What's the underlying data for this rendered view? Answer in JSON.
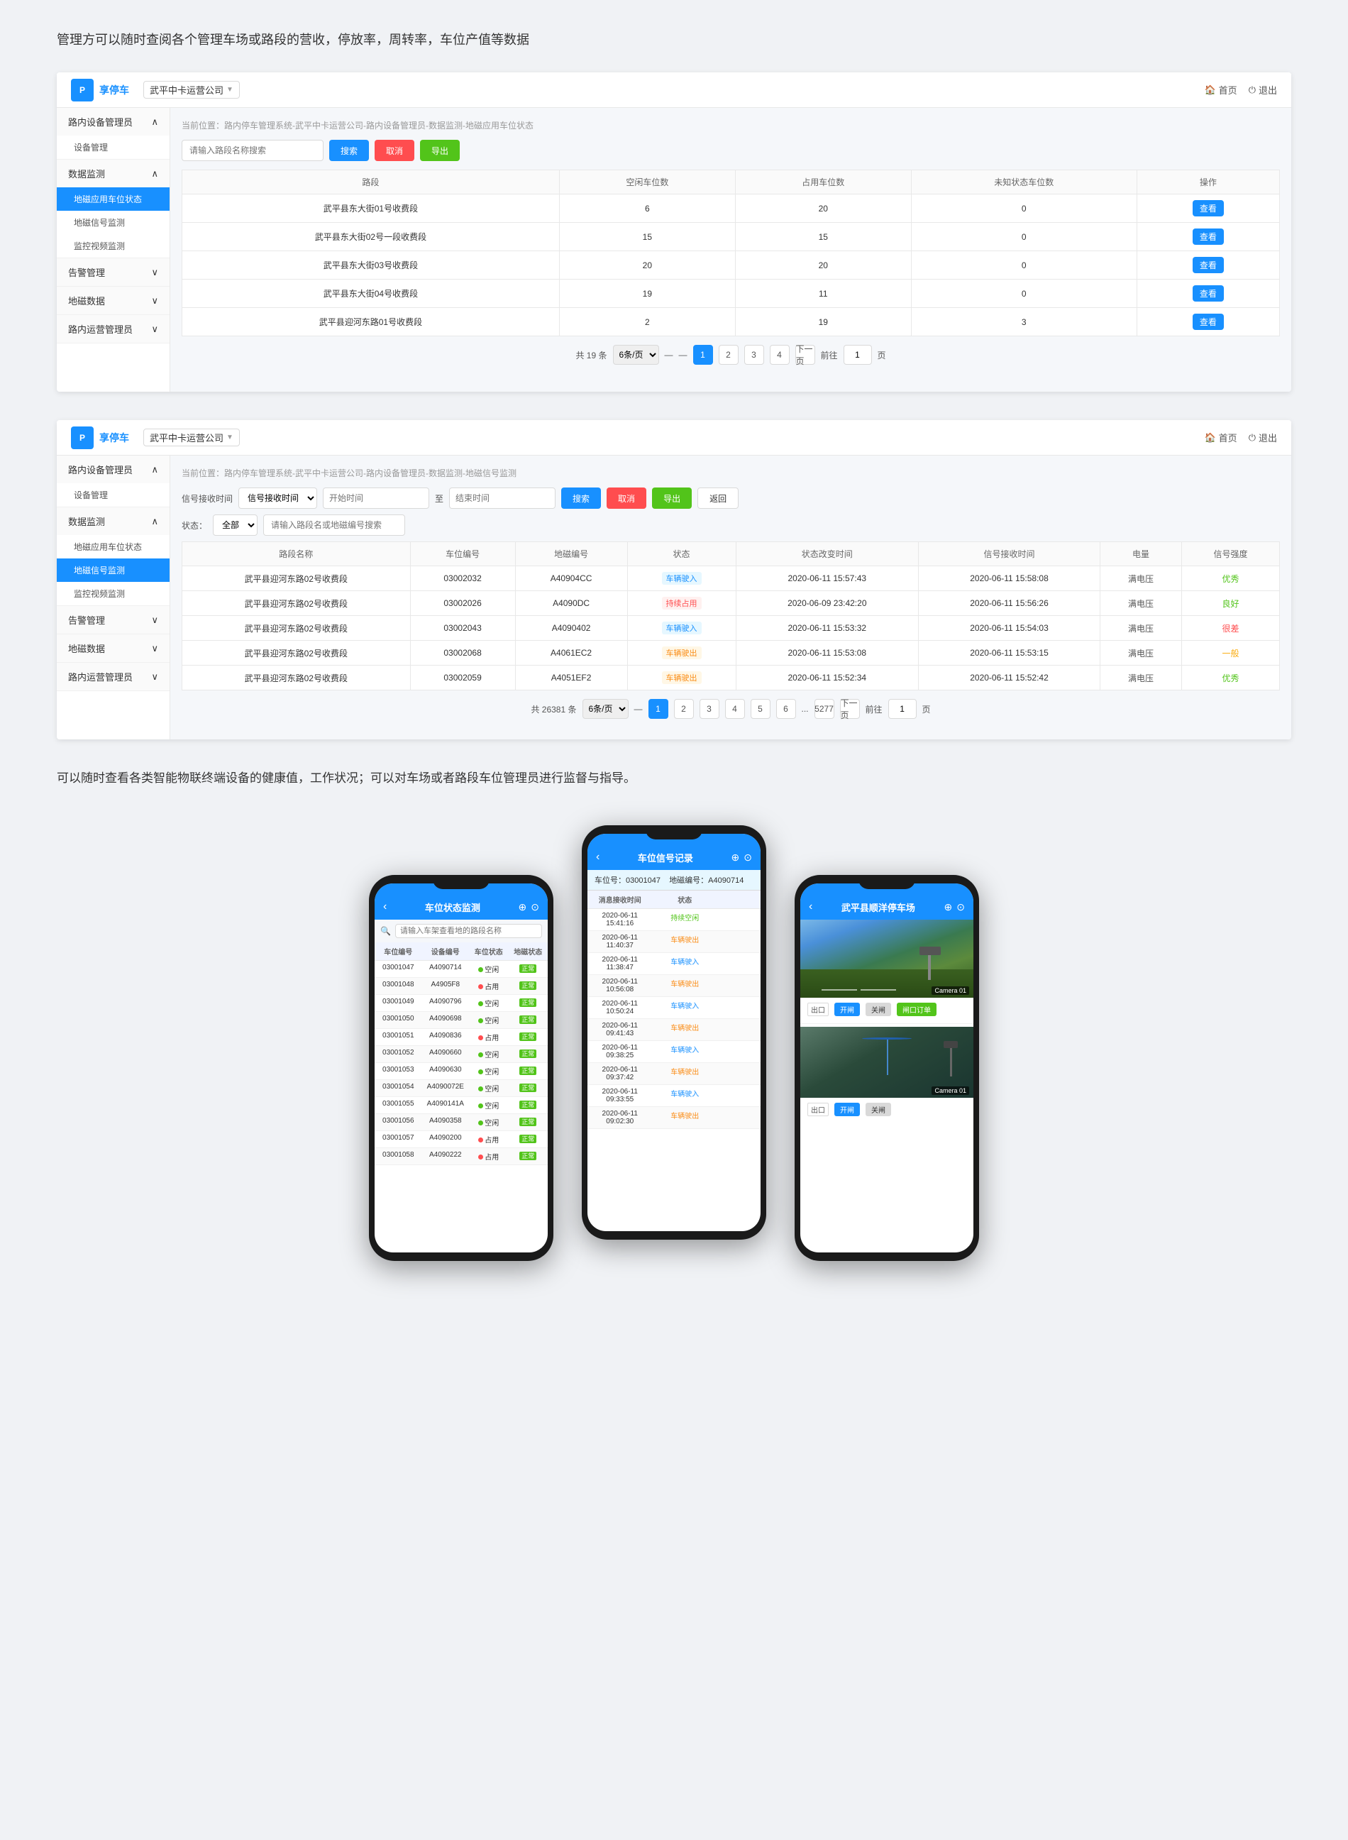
{
  "intro1": {
    "text": "管理方可以随时查阅各个管理车场或路段的营收，停放率，周转率，车位产值等数据"
  },
  "intro2": {
    "text": "可以随时查看各类智能物联终端设备的健康值，工作状况；可以对车场或者路段车位管理员进行监督与指导。"
  },
  "panel1": {
    "topbar": {
      "logo": "P享停车",
      "company": "武平中卡运营公司",
      "nav_home": "首页",
      "nav_logout": "退出"
    },
    "breadcrumb": "当前位置：路内停车管理系统-武平中卡运营公司-路内设备管理员-数据监测-地磁应用车位状态",
    "sidebar": {
      "section1": "路内设备管理员",
      "item1": "设备管理",
      "section2": "数据监测",
      "item2_1": "地磁应用车位状态",
      "item2_2": "地磁信号监测",
      "item2_3": "监控视频监测",
      "section3": "告警管理",
      "section4": "地磁数据",
      "section5": "路内运营管理员"
    },
    "search_placeholder": "请输入路段名称搜索",
    "btn_search": "搜索",
    "btn_reset": "取消",
    "btn_export": "导出",
    "table": {
      "headers": [
        "路段",
        "空闲车位数",
        "占用车位数",
        "未知状态车位数",
        "操作"
      ],
      "rows": [
        {
          "name": "武平县东大街01号收费段",
          "free": "6",
          "occupied": "20",
          "unknown": "0"
        },
        {
          "name": "武平县东大街02号一段收费段",
          "free": "15",
          "occupied": "15",
          "unknown": "0"
        },
        {
          "name": "武平县东大街03号收费段",
          "free": "20",
          "occupied": "20",
          "unknown": "0"
        },
        {
          "name": "武平县东大街04号收费段",
          "free": "19",
          "occupied": "11",
          "unknown": "0"
        },
        {
          "name": "武平县迎河东路01号收费段",
          "free": "2",
          "occupied": "19",
          "unknown": "3"
        }
      ],
      "btn_view": "查看"
    },
    "pagination": {
      "total": "共 19 条",
      "per_page": "6条/页",
      "pages": [
        "1",
        "2",
        "3",
        "4"
      ],
      "next": "下一页",
      "prev": "前往",
      "go_page": "1",
      "page_unit": "页"
    }
  },
  "panel2": {
    "topbar": {
      "logo": "P享停车",
      "company": "武平中卡运营公司",
      "nav_home": "首页",
      "nav_logout": "退出"
    },
    "breadcrumb": "当前位置：路内停车管理系统-武平中卡运营公司-路内设备管理员-数据监测-地磁信号监测",
    "sidebar": {
      "section1": "路内设备管理员",
      "item1": "设备管理",
      "section2": "数据监测",
      "item2_1": "地磁应用车位状态",
      "item2_2": "地磁信号监测",
      "item2_3": "监控视频监测",
      "section3": "告警管理",
      "section4": "地磁数据",
      "section5": "路内运营管理员"
    },
    "toolbar": {
      "label_time": "信号接收时间",
      "placeholder_start": "开始时间",
      "separator": "至",
      "placeholder_end": "结束时间",
      "btn_search": "搜索",
      "btn_reset": "取消",
      "btn_export": "导出",
      "btn_back": "返回",
      "label_status": "状态：",
      "status_options": [
        "全部"
      ],
      "search_placeholder": "请输入路段名或地磁编号搜索"
    },
    "table": {
      "headers": [
        "路段名称",
        "车位编号",
        "地磁编号",
        "状态",
        "状态改变时间",
        "信号接收时间",
        "电量",
        "信号强度"
      ],
      "rows": [
        {
          "name": "武平县迎河东路02号收费段",
          "slot": "03002032",
          "geo": "A40904CC",
          "status": "车辆驶入",
          "status_time": "2020-06-11 15:57:43",
          "signal_time": "2020-06-11 15:58:08",
          "power": "满电压",
          "quality": "优秀"
        },
        {
          "name": "武平县迎河东路02号收费段",
          "slot": "03002026",
          "geo": "A4090DC",
          "status": "持续占用",
          "status_time": "2020-06-09 23:42:20",
          "signal_time": "2020-06-11 15:56:26",
          "power": "满电压",
          "quality": "良好"
        },
        {
          "name": "武平县迎河东路02号收费段",
          "slot": "03002043",
          "geo": "A4090402",
          "status": "车辆驶入",
          "status_time": "2020-06-11 15:53:32",
          "signal_time": "2020-06-11 15:54:03",
          "power": "满电压",
          "quality": "很差"
        },
        {
          "name": "武平县迎河东路02号收费段",
          "slot": "03002068",
          "geo": "A4061EC2",
          "status": "车辆驶出",
          "status_time": "2020-06-11 15:53:08",
          "signal_time": "2020-06-11 15:53:15",
          "power": "满电压",
          "quality": "一般"
        },
        {
          "name": "武平县迎河东路02号收费段",
          "slot": "03002059",
          "geo": "A4051EF2",
          "status": "车辆驶出",
          "status_time": "2020-06-11 15:52:34",
          "signal_time": "2020-06-11 15:52:42",
          "power": "满电压",
          "quality": "优秀"
        }
      ]
    },
    "pagination": {
      "total": "共 26381 条",
      "per_page": "6条/页",
      "pages": [
        "1",
        "2",
        "3",
        "4",
        "5",
        "6",
        "...",
        "5277"
      ],
      "next": "下一页",
      "prev": "前往",
      "go_page": "1",
      "page_unit": "页"
    }
  },
  "phone1": {
    "title": "车位状态监测",
    "search_placeholder": "请输入车架查看地的路段名称",
    "table_headers": [
      "车位编号",
      "设备编号",
      "车位状态",
      "地磁状态"
    ],
    "rows": [
      {
        "slot": "03001047",
        "device": "A4090714",
        "slot_status": "空闲",
        "geo_status": "正常"
      },
      {
        "slot": "03001048",
        "device": "A4905F8",
        "slot_status": "占用",
        "geo_status": "正常"
      },
      {
        "slot": "03001049",
        "device": "A4090796",
        "slot_status": "空闲",
        "geo_status": "正常"
      },
      {
        "slot": "03001050",
        "device": "A4090698",
        "slot_status": "空闲",
        "geo_status": "正常"
      },
      {
        "slot": "03001051",
        "device": "A4090836",
        "slot_status": "占用",
        "geo_status": "正常"
      },
      {
        "slot": "03001052",
        "device": "A4090660",
        "slot_status": "空闲",
        "geo_status": "正常"
      },
      {
        "slot": "03001053",
        "device": "A4090630",
        "slot_status": "空闲",
        "geo_status": "正常"
      },
      {
        "slot": "03001054",
        "device": "A4090072E",
        "slot_status": "空闲",
        "geo_status": "正常"
      },
      {
        "slot": "03001055",
        "device": "A4090141A",
        "slot_status": "空闲",
        "geo_status": "正常"
      },
      {
        "slot": "03001056",
        "device": "A4090358",
        "slot_status": "空闲",
        "geo_status": "正常"
      },
      {
        "slot": "03001057",
        "device": "A4090200",
        "slot_status": "占用",
        "geo_status": "正常"
      },
      {
        "slot": "03001058",
        "device": "A4090222",
        "slot_status": "占用",
        "geo_status": "正常"
      }
    ]
  },
  "phone2": {
    "title": "车位信号记录",
    "info": {
      "slot_id": "车位号：03001047",
      "geo_id": "地磁编号：A4090714"
    },
    "table_headers": [
      "消息接收时间",
      "状态"
    ],
    "rows": [
      {
        "time": "2020-06-11 15:41:16",
        "status": "持续空闲"
      },
      {
        "time": "2020-06-11 11:40:37",
        "status": "车辆驶出"
      },
      {
        "time": "2020-06-11 11:38:47",
        "status": "车辆驶入"
      },
      {
        "time": "2020-06-11 10:56:08",
        "status": "车辆驶出"
      },
      {
        "time": "2020-06-11 10:50:24",
        "status": "车辆驶入"
      },
      {
        "time": "2020-06-11 09:41:43",
        "status": "车辆驶出"
      },
      {
        "time": "2020-06-11 09:38:25",
        "status": "车辆驶入"
      },
      {
        "time": "2020-06-11 09:37:42",
        "status": "车辆驶出"
      },
      {
        "time": "2020-06-11 09:33:55",
        "status": "车辆驶入"
      },
      {
        "time": "2020-06-11 09:02:30",
        "status": "车辆驶出"
      }
    ]
  },
  "phone3": {
    "title": "武平县顺洋停车场",
    "entry_label": "出口",
    "exit_label": "出口",
    "cam1_label": "Camera 01",
    "cam2_label": "Camera 01",
    "entry_btn_open": "开闸",
    "entry_btn_close": "关闸",
    "entry_btn_order": "闸口订单",
    "exit_btn_open": "开闸",
    "exit_btn_close": "关闸"
  }
}
